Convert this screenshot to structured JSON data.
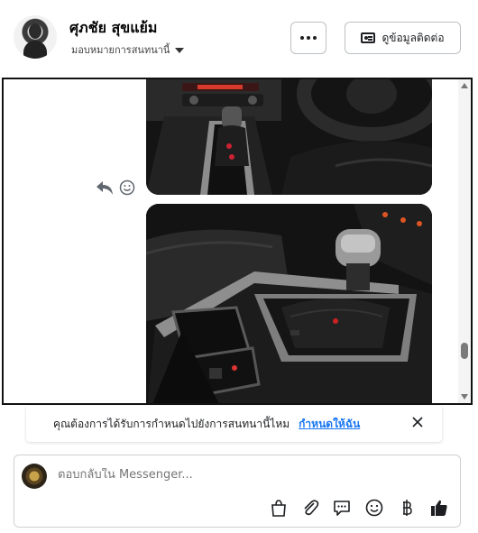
{
  "header": {
    "name": "ศุภชัย สุขแย้ม",
    "assign_label": "มอบหมายการสนทนานี้",
    "more_icon": "more-horizontal-icon",
    "contact_label": "ดูข้อมูลติดต่อ",
    "contact_icon": "contact-card-icon"
  },
  "messages": {
    "items": [
      {
        "type": "image",
        "content": "car interior dashboard and steering wheel"
      },
      {
        "type": "image",
        "content": "car automatic gear shifter and center console"
      }
    ],
    "actions": [
      "reply-icon",
      "emoji-reaction-icon"
    ]
  },
  "banner": {
    "text": "คุณต้องการได้รับการกำหนดไปยังการสนทนานี้ไหม",
    "link": "กำหนดให้ฉัน",
    "close_icon": "close-icon"
  },
  "composer": {
    "placeholder": "ตอบกลับใน Messenger...",
    "tools": [
      "shopping-bag-icon",
      "paperclip-icon",
      "saved-replies-icon",
      "emoji-icon",
      "baht-icon",
      "thumbs-up-icon"
    ]
  },
  "colors": {
    "accent": "#1877f2",
    "text": "#050505",
    "secondary": "#65676b",
    "border": "#bcc0c4"
  }
}
